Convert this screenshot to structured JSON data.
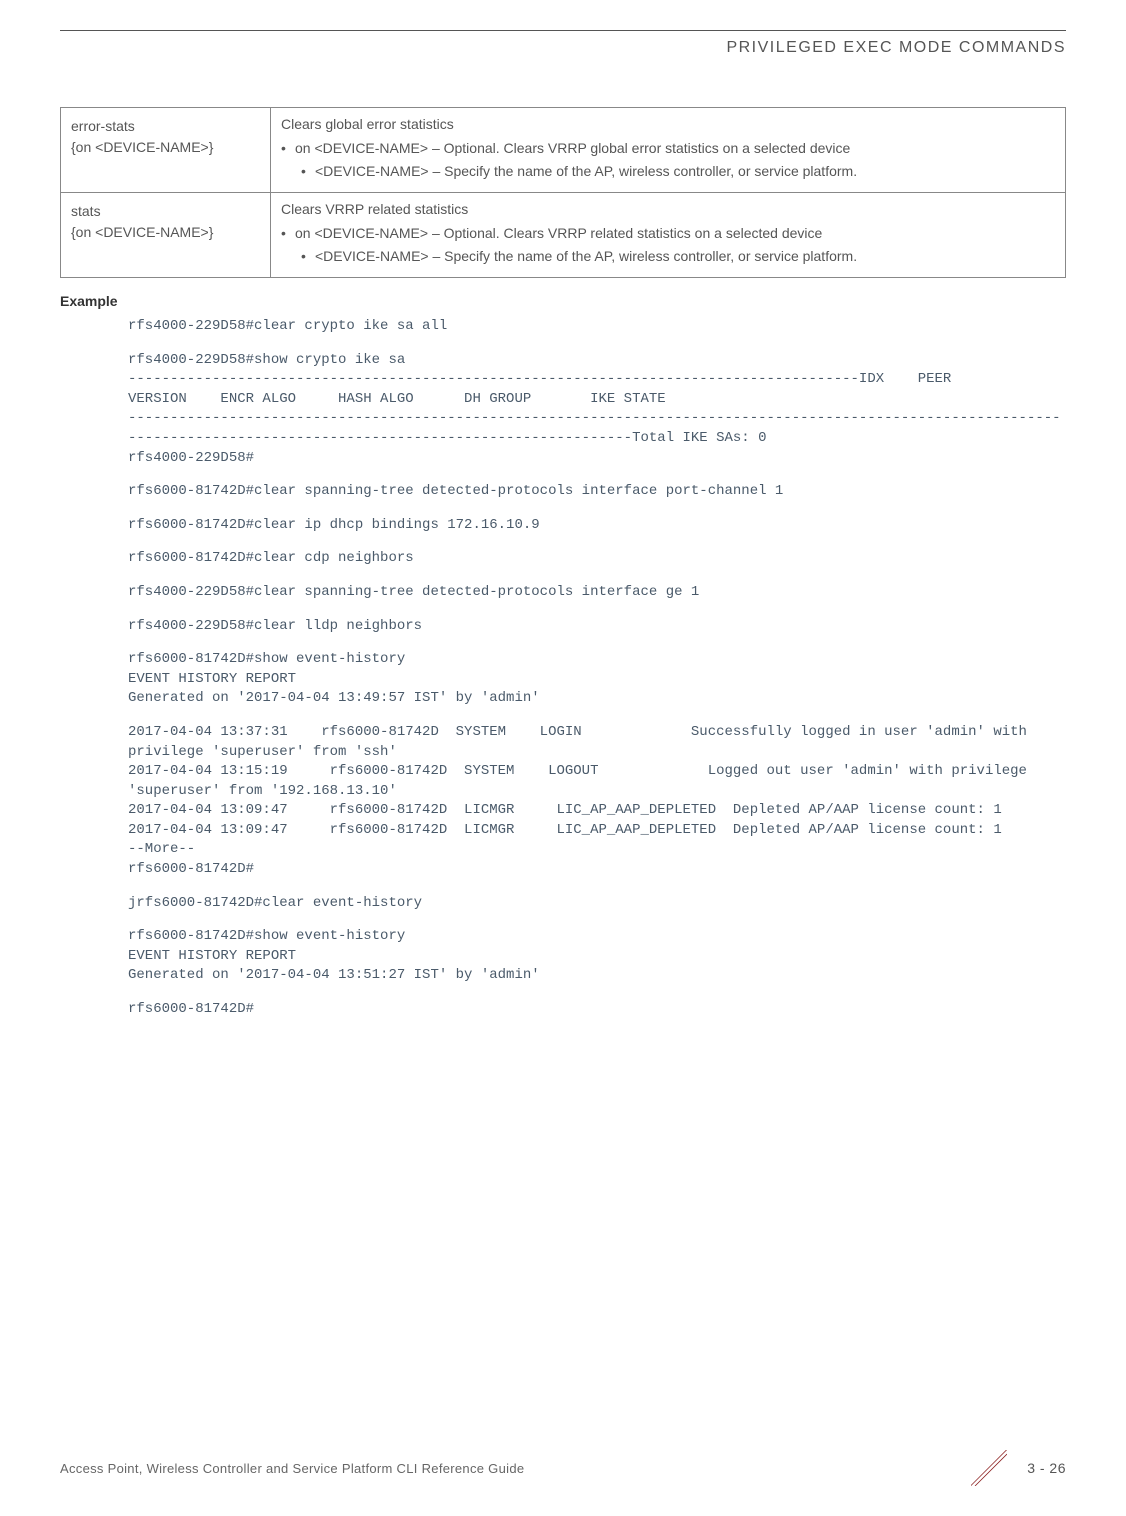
{
  "header": {
    "title": "PRIVILEGED EXEC MODE COMMANDS"
  },
  "table": {
    "rows": [
      {
        "name_line1": "error-stats",
        "name_line2": "{on <DEVICE-NAME>}",
        "desc_head": "Clears global error statistics",
        "bullet1": "on <DEVICE-NAME> – Optional. Clears VRRP global error statistics on a selected device",
        "bullet2": "<DEVICE-NAME> – Specify the name of the AP, wireless controller, or service platform."
      },
      {
        "name_line1": "stats",
        "name_line2": "{on <DEVICE-NAME>}",
        "desc_head": "Clears VRRP related statistics",
        "bullet1": "on <DEVICE-NAME> – Optional. Clears VRRP related statistics on a selected device",
        "bullet2": "<DEVICE-NAME> – Specify the name of the AP, wireless controller, or service platform."
      }
    ]
  },
  "example_label": "Example",
  "code": {
    "b1": "rfs4000-229D58#clear crypto ike sa all",
    "b2": "rfs4000-229D58#show crypto ike sa\n---------------------------------------------------------------------------------------IDX    PEER        VERSION    ENCR ALGO     HASH ALGO      DH GROUP       IKE STATE\n---------------------------------------------------------------------------------------------------------------------------------------------------------------------------Total IKE SAs: 0\nrfs4000-229D58#",
    "b3": "rfs6000-81742D#clear spanning-tree detected-protocols interface port-channel 1",
    "b4": "rfs6000-81742D#clear ip dhcp bindings 172.16.10.9",
    "b5": "rfs6000-81742D#clear cdp neighbors",
    "b6": "rfs4000-229D58#clear spanning-tree detected-protocols interface ge 1",
    "b7": "rfs4000-229D58#clear lldp neighbors",
    "b8": "rfs6000-81742D#show event-history\nEVENT HISTORY REPORT\nGenerated on '2017-04-04 13:49:57 IST' by 'admin'",
    "b9": "2017-04-04 13:37:31    rfs6000-81742D  SYSTEM    LOGIN             Successfully logged in user 'admin' with privilege 'superuser' from 'ssh'\n2017-04-04 13:15:19     rfs6000-81742D  SYSTEM    LOGOUT             Logged out user 'admin' with privilege 'superuser' from '192.168.13.10'\n2017-04-04 13:09:47     rfs6000-81742D  LICMGR     LIC_AP_AAP_DEPLETED  Depleted AP/AAP license count: 1\n2017-04-04 13:09:47     rfs6000-81742D  LICMGR     LIC_AP_AAP_DEPLETED  Depleted AP/AAP license count: 1\n--More--\nrfs6000-81742D#",
    "b10": "jrfs6000-81742D#clear event-history",
    "b11": "rfs6000-81742D#show event-history\nEVENT HISTORY REPORT\nGenerated on '2017-04-04 13:51:27 IST' by 'admin'",
    "b12": "rfs6000-81742D#"
  },
  "footer": {
    "text": "Access Point, Wireless Controller and Service Platform CLI Reference Guide",
    "page": "3 - 26"
  }
}
